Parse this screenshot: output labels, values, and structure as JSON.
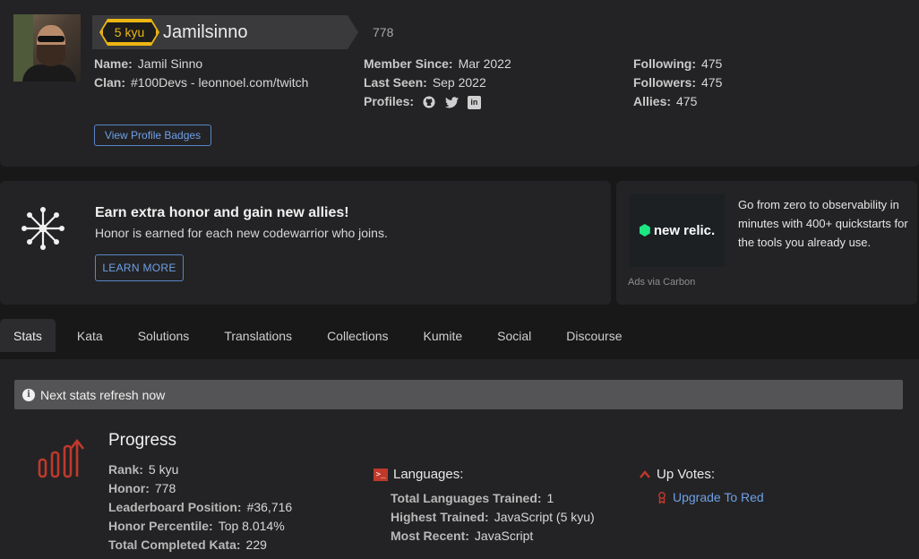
{
  "profile": {
    "rank": "5 kyu",
    "username": "Jamilsinno",
    "honor": "778",
    "name_label": "Name:",
    "name_value": "Jamil Sinno",
    "clan_label": "Clan:",
    "clan_value": "#100Devs - leonnoel.com/twitch",
    "member_since_label": "Member Since:",
    "member_since_value": "Mar 2022",
    "last_seen_label": "Last Seen:",
    "last_seen_value": "Sep 2022",
    "profiles_label": "Profiles:",
    "following_label": "Following:",
    "following_value": "475",
    "followers_label": "Followers:",
    "followers_value": "475",
    "allies_label": "Allies:",
    "allies_value": "475",
    "badges_button": "View Profile Badges"
  },
  "promo": {
    "title": "Earn extra honor and gain new allies!",
    "subtitle": "Honor is earned for each new codewarrior who joins.",
    "button": "LEARN MORE"
  },
  "ad": {
    "logo_text": "new relic.",
    "text": "Go from zero to observability in minutes with 400+ quickstarts for the tools you already use.",
    "via": "Ads via Carbon"
  },
  "tabs": [
    {
      "label": "Stats"
    },
    {
      "label": "Kata"
    },
    {
      "label": "Solutions"
    },
    {
      "label": "Translations"
    },
    {
      "label": "Collections"
    },
    {
      "label": "Kumite"
    },
    {
      "label": "Social"
    },
    {
      "label": "Discourse"
    }
  ],
  "notice": "Next stats refresh now",
  "progress": {
    "title": "Progress",
    "rank_label": "Rank:",
    "rank_value": "5 kyu",
    "honor_label": "Honor:",
    "honor_value": "778",
    "leaderboard_label": "Leaderboard Position:",
    "leaderboard_value": "#36,716",
    "percentile_label": "Honor Percentile:",
    "percentile_value": "Top 8.014%",
    "completed_label": "Total Completed Kata:",
    "completed_value": "229"
  },
  "languages": {
    "title": "Languages:",
    "trained_label": "Total Languages Trained:",
    "trained_value": "1",
    "highest_label": "Highest Trained:",
    "highest_value": "JavaScript (5 kyu)",
    "recent_label": "Most Recent:",
    "recent_value": "JavaScript"
  },
  "upvotes": {
    "title": "Up Votes:",
    "upgrade_link": "Upgrade To Red"
  },
  "colors": {
    "background": "#181819",
    "card": "#232325",
    "rank_yellow": "#ecb613",
    "accent_red": "#c0392b",
    "link_blue": "#6ea0e6"
  }
}
